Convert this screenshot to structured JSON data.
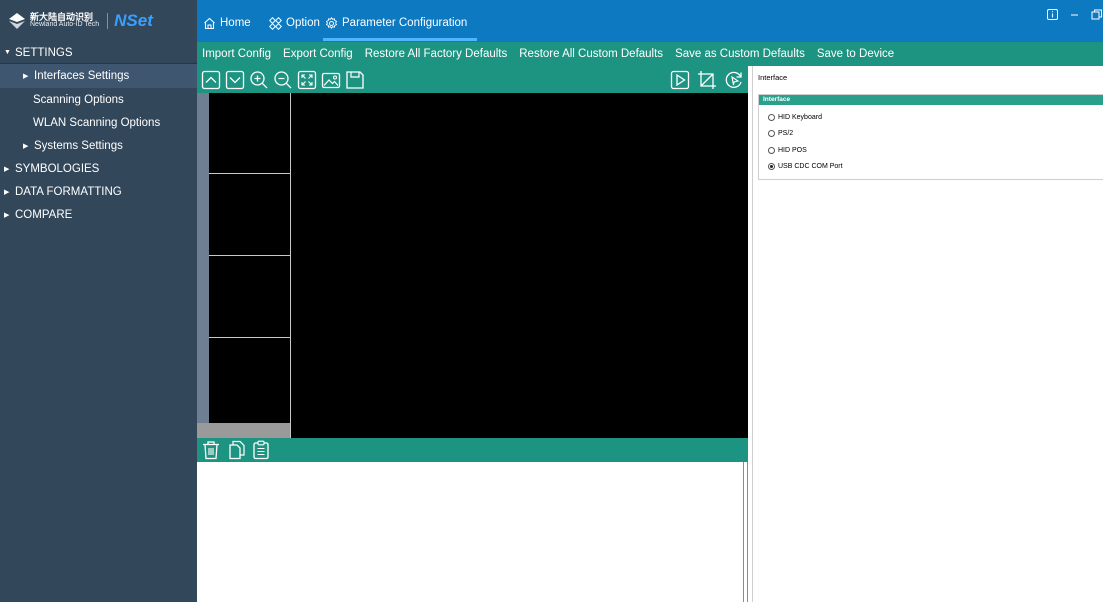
{
  "app": {
    "logo_company_line1": "新大陆自动识别",
    "logo_company_line2": "Newland Auto-ID Tech",
    "logo_name": "NSet"
  },
  "tabs": [
    {
      "label": "Home",
      "icon": "home-icon"
    },
    {
      "label": "Option",
      "icon": "option-icon"
    },
    {
      "label": "Parameter Configuration",
      "icon": "gear-icon",
      "active": true
    }
  ],
  "window_controls": [
    "info-icon",
    "minimize-icon",
    "restore-icon"
  ],
  "menu": [
    "Import Config",
    "Export Config",
    "Restore All Factory Defaults",
    "Restore All Custom Defaults",
    "Save as Custom Defaults",
    "Save to Device"
  ],
  "sidebar": {
    "settings": "SETTINGS",
    "interfaces": "Interfaces Settings",
    "scanning": "Scanning Options",
    "wlan": "WLAN Scanning Options",
    "systems": "Systems Settings",
    "symbologies": "SYMBOLOGIES",
    "data_formatting": "DATA FORMATTING",
    "compare": "COMPARE"
  },
  "image_toolbar": {
    "left": [
      "chevron-up-icon",
      "chevron-down-icon",
      "zoom-in-icon",
      "zoom-out-icon",
      "fit-screen-icon",
      "image-icon",
      "save-icon"
    ],
    "right": [
      "play-icon",
      "crop-icon",
      "refresh-icon"
    ]
  },
  "result_toolbar": [
    "delete-icon",
    "copy-icon",
    "paste-icon"
  ],
  "right_panel": {
    "header": "Interface",
    "group_title": "Interface",
    "options": [
      {
        "label": "HID Keyboard",
        "checked": false
      },
      {
        "label": "PS/2",
        "checked": false
      },
      {
        "label": "HID POS",
        "checked": false
      },
      {
        "label": "USB CDC COM Port",
        "checked": true
      }
    ]
  },
  "colors": {
    "sidebar": "#33475b",
    "titlebar": "#0c79c1",
    "toolbar": "#1d9481",
    "accent": "#2aa08c",
    "logo": "#3aa0ff"
  }
}
